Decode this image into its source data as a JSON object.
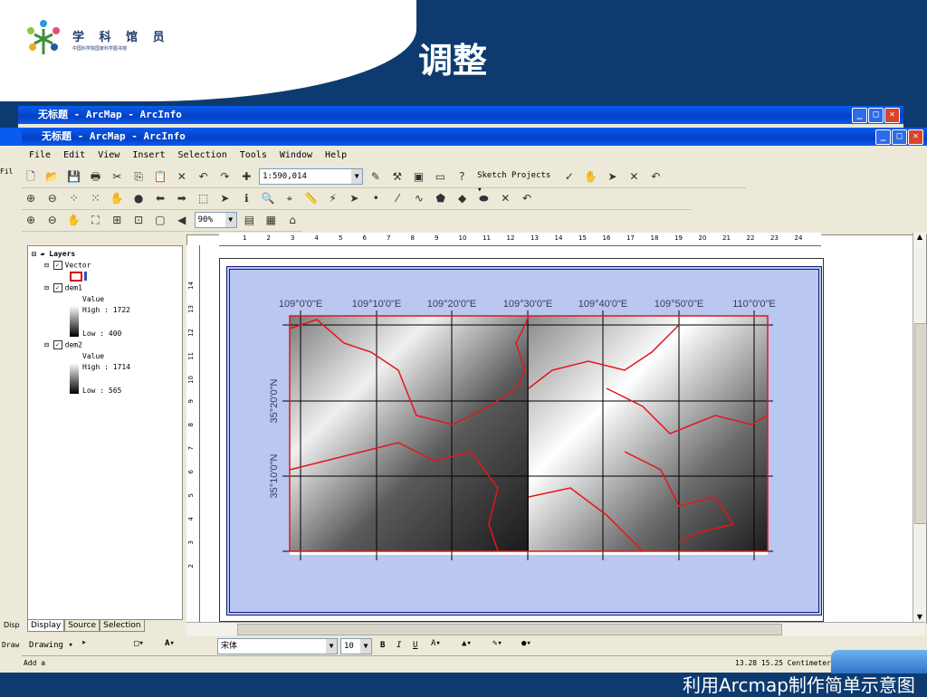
{
  "slide": {
    "logo_title": "学 科 馆 员",
    "logo_subtitle": "中国科学院国家科学图书馆",
    "title": "调整",
    "caption": "利用Arcmap制作简单示意图"
  },
  "window": {
    "title": "无标题 - ArcMap - ArcInfo",
    "controls": {
      "minimize": "_",
      "maximize": "□",
      "close": "✕"
    }
  },
  "menu": [
    "File",
    "Edit",
    "View",
    "Insert",
    "Selection",
    "Tools",
    "Window",
    "Help"
  ],
  "toolbar": {
    "scale": "1:590,014",
    "sketch_projects": "Sketch Projects ▾",
    "zoom": "90%"
  },
  "toc": {
    "root": "Layers",
    "layers": [
      {
        "name": "Vector"
      },
      {
        "name": "dem1",
        "field": "Value",
        "high": "High : 1722",
        "low": "Low : 400"
      },
      {
        "name": "dem2",
        "field": "Value",
        "high": "High : 1714",
        "low": "Low : 565"
      }
    ],
    "tabs": [
      "Display",
      "Source",
      "Selection"
    ],
    "cut_tab": "Disp"
  },
  "ruler": [
    "1",
    "2",
    "3",
    "4",
    "5",
    "6",
    "7",
    "8",
    "9",
    "10",
    "11",
    "12",
    "13",
    "14",
    "15",
    "16",
    "17",
    "18",
    "19",
    "20",
    "21",
    "22",
    "23",
    "24"
  ],
  "ruler_left": [
    "14",
    "13",
    "12",
    "11",
    "10",
    "9",
    "8",
    "7",
    "6",
    "5",
    "4",
    "3",
    "2"
  ],
  "map": {
    "longitude_labels": [
      "109°0'0\"E",
      "109°10'0\"E",
      "109°20'0\"E",
      "109°30'0\"E",
      "109°40'0\"E",
      "109°50'0\"E",
      "110°0'0\"E"
    ],
    "latitude_labels": [
      "35°20'0\"N",
      "35°10'0\"N"
    ],
    "colors": {
      "frame": "#b9c7f1",
      "boundary": "#e3161b",
      "grid": "#000000"
    }
  },
  "drawing": {
    "label": "Drawing ▾",
    "font": "宋体",
    "size": "10",
    "bold": "B",
    "italic": "I",
    "underline": "U"
  },
  "status": {
    "left": "Add a",
    "coords": "13.28  15.25 Centimeters"
  },
  "back_window_cut_labels": [
    "Fil",
    "Disp",
    "Draw"
  ]
}
